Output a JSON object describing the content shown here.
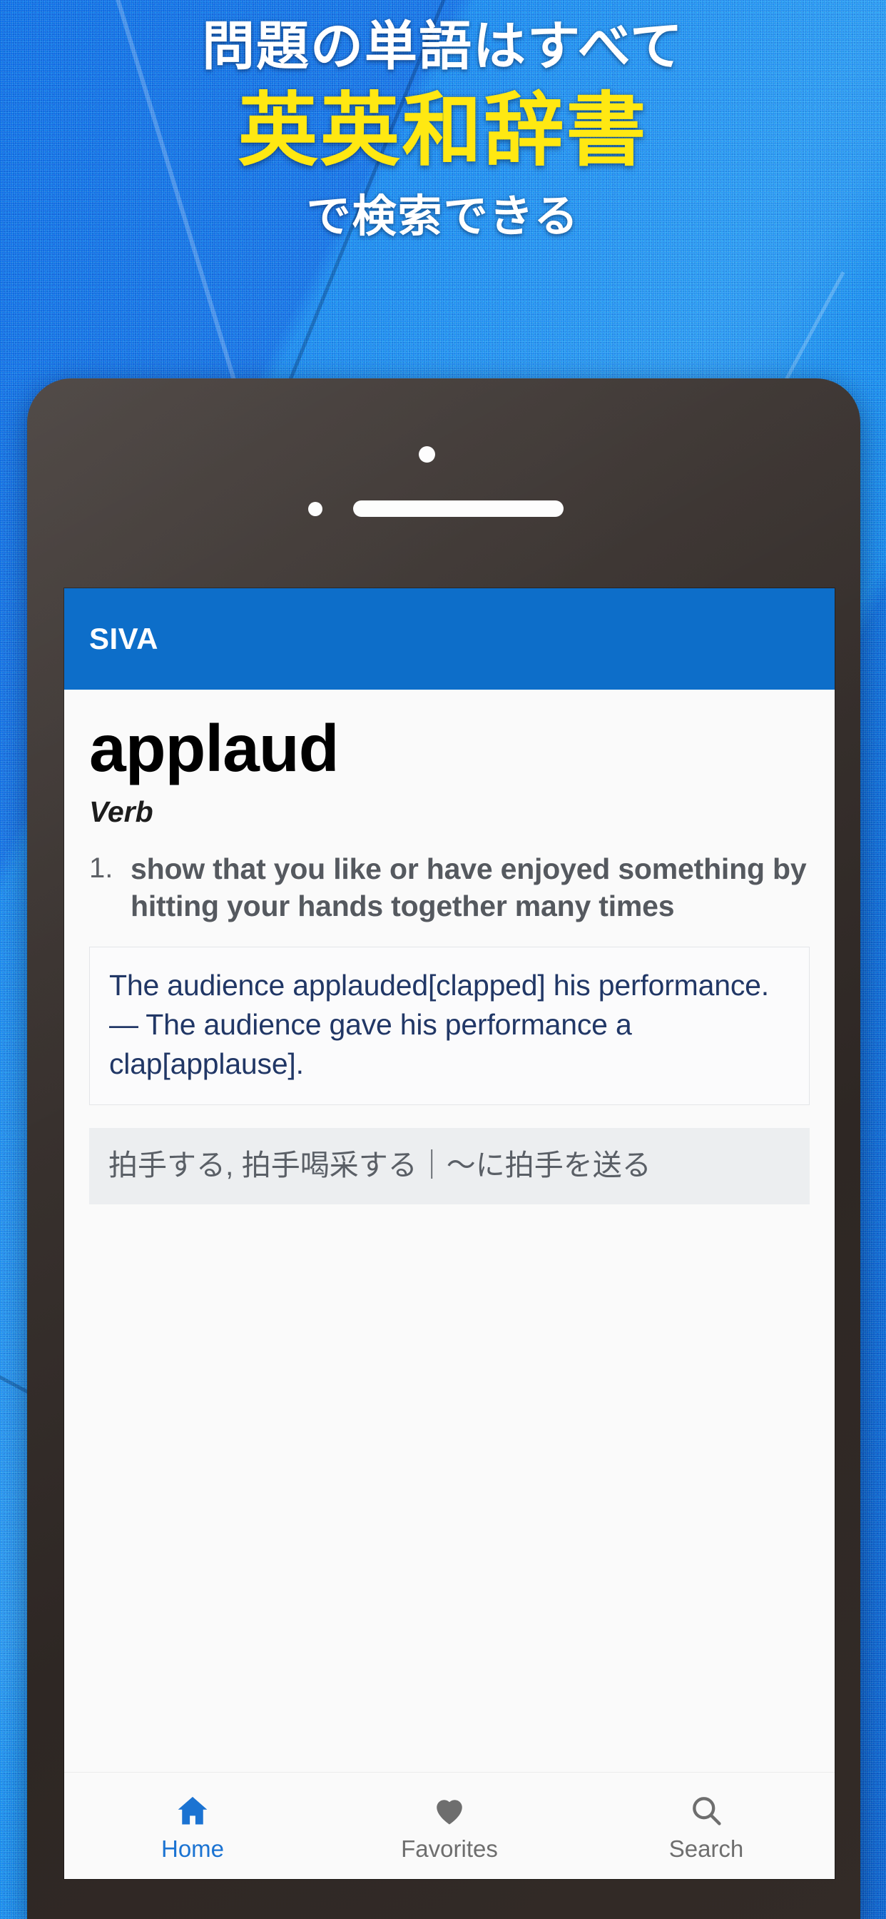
{
  "poster": {
    "headline_line1": "問題の単語はすべて",
    "headline_line2": "英英和辞書",
    "headline_line3": "で検索できる",
    "headline_line1_color": "#ffffff",
    "headline_line2_color": "#ffe812",
    "headline_line3_color": "#ffffff",
    "background_color": "#0e6fe6"
  },
  "device": {
    "camera_icon": "camera-dot",
    "sensor_icon": "sensor-dot",
    "speaker_icon": "speaker-grille",
    "frame_color": "#2e2724"
  },
  "app": {
    "appbar": {
      "title": "SIVA",
      "background_color": "#0d6ec9",
      "title_color": "#ffffff"
    },
    "entry": {
      "word": "applaud",
      "part_of_speech": "Verb",
      "senses": [
        {
          "number": "1.",
          "definition": "show that you like or have enjoyed something by hitting your hands together many times",
          "example": "The audience applauded[clapped] his performance. — The audience gave his performance a clap[applause].",
          "translation": "拍手する, 拍手喝采する｜〜に拍手を送る"
        }
      ],
      "example_text_color": "#213766",
      "translation_background": "#eceef0",
      "translation_text_color": "#5a5f66"
    },
    "bottom_nav": {
      "active_color": "#1b73d2",
      "inactive_color": "#6e6e6e",
      "items": [
        {
          "label": "Home",
          "icon": "home-icon",
          "active": true
        },
        {
          "label": "Favorites",
          "icon": "heart-icon",
          "active": false
        },
        {
          "label": "Search",
          "icon": "search-icon",
          "active": false
        }
      ]
    }
  }
}
